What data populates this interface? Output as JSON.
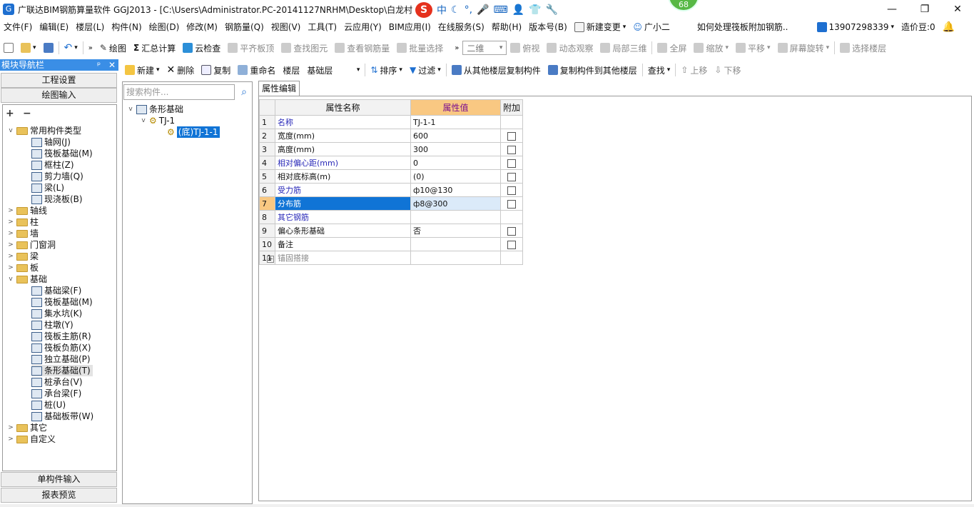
{
  "window": {
    "title": "广联达BIM钢筋算量软件 GGJ2013 - [C:\\Users\\Administrator.PC-20141127NRHM\\Desktop\\白龙村-...2]",
    "app_icon": "G",
    "minimize": "—",
    "maximize": "❐",
    "close": "✕"
  },
  "ime": {
    "logo": "S",
    "mode": "中",
    "icons": [
      "moon-icon",
      "punct-icon",
      "mic-icon",
      "keyboard-icon",
      "user-icon",
      "shirt-icon",
      "wrench-icon"
    ]
  },
  "badge": "68",
  "menu": {
    "items": [
      "文件(F)",
      "编辑(E)",
      "楼层(L)",
      "构件(N)",
      "绘图(D)",
      "修改(M)",
      "钢筋量(Q)",
      "视图(V)",
      "工具(T)",
      "云应用(Y)",
      "BIM应用(I)",
      "在线服务(S)",
      "帮助(H)",
      "版本号(B)"
    ],
    "new_change": "新建变更",
    "new_change_arrow": "▾",
    "assistant": "广小二",
    "question": "如何处理筏板附加钢筋..",
    "phone": "13907298339",
    "phone_arrow": "▾",
    "beans": "造价豆:0"
  },
  "toolbar1": {
    "draw": "绘图",
    "sum": "汇总计算",
    "cloud_check": "云检查",
    "flush_slab": "平齐板顶",
    "find_element": "查找图元",
    "view_rebar": "查看钢筋量",
    "batch_select": "批量选择",
    "view_mode": "二维",
    "top_view": "俯视",
    "dynamic_view": "动态观察",
    "local_3d": "局部三维",
    "fullscreen": "全屏",
    "zoom": "缩放",
    "pan": "平移",
    "rotate": "屏幕旋转",
    "select_floor": "选择楼层"
  },
  "nav": {
    "header": "模块导航栏",
    "pin": "ᵖ",
    "close": "✕",
    "project_settings": "工程设置",
    "drawing_input": "绘图输入",
    "single_input": "单构件输入",
    "report_preview": "报表预览",
    "expand_all": "+",
    "collapse_all": "−",
    "tree": {
      "common": "常用构件类型",
      "common_items": [
        "轴网(J)",
        "筏板基础(M)",
        "框柱(Z)",
        "剪力墙(Q)",
        "梁(L)",
        "现浇板(B)"
      ],
      "folders1": [
        "轴线",
        "柱",
        "墙",
        "门窗洞",
        "梁",
        "板"
      ],
      "foundation": "基础",
      "foundation_items": [
        "基础梁(F)",
        "筏板基础(M)",
        "集水坑(K)",
        "柱墩(Y)",
        "筏板主筋(R)",
        "筏板负筋(X)",
        "独立基础(P)",
        "条形基础(T)",
        "桩承台(V)",
        "承台梁(F)",
        "桩(U)",
        "基础板带(W)"
      ],
      "folders2": [
        "其它",
        "自定义"
      ]
    }
  },
  "toolbar2": {
    "new": "新建",
    "delete": "删除",
    "copy": "复制",
    "rename": "重命名",
    "floor_label": "楼层",
    "floor_value": "基础层",
    "sort": "排序",
    "filter": "过滤",
    "copy_from": "从其他楼层复制构件",
    "copy_to": "复制构件到其他楼层",
    "find": "查找",
    "move_up": "上移",
    "move_down": "下移"
  },
  "components": {
    "search_placeholder": "搜索构件...",
    "root": "条形基础",
    "child": "TJ-1",
    "leaf": "(底)TJ-1-1"
  },
  "properties": {
    "tab": "属性编辑",
    "headers": {
      "name": "属性名称",
      "value": "属性值",
      "add": "附加"
    },
    "rows": [
      {
        "n": "1",
        "name": "名称",
        "value": "TJ-1-1",
        "cb": false,
        "style": "blue"
      },
      {
        "n": "2",
        "name": "宽度(mm)",
        "value": "600",
        "cb": true,
        "style": ""
      },
      {
        "n": "3",
        "name": "高度(mm)",
        "value": "300",
        "cb": true,
        "style": ""
      },
      {
        "n": "4",
        "name": "相对偏心距(mm)",
        "value": "0",
        "cb": true,
        "style": "blue"
      },
      {
        "n": "5",
        "name": "相对底标高(m)",
        "value": "(0)",
        "cb": true,
        "style": ""
      },
      {
        "n": "6",
        "name": "受力筋",
        "value": "ф10@130",
        "cb": true,
        "style": "blue"
      },
      {
        "n": "7",
        "name": "分布筋",
        "value": "ф8@300",
        "cb": true,
        "style": "sel"
      },
      {
        "n": "8",
        "name": "其它钢筋",
        "value": "",
        "cb": false,
        "style": "blue"
      },
      {
        "n": "9",
        "name": "偏心条形基础",
        "value": "否",
        "cb": true,
        "style": ""
      },
      {
        "n": "10",
        "name": "备注",
        "value": "",
        "cb": true,
        "style": ""
      },
      {
        "n": "11",
        "name": "锚固搭接",
        "value": "",
        "cb": false,
        "style": "gray"
      }
    ],
    "expander": "+"
  }
}
